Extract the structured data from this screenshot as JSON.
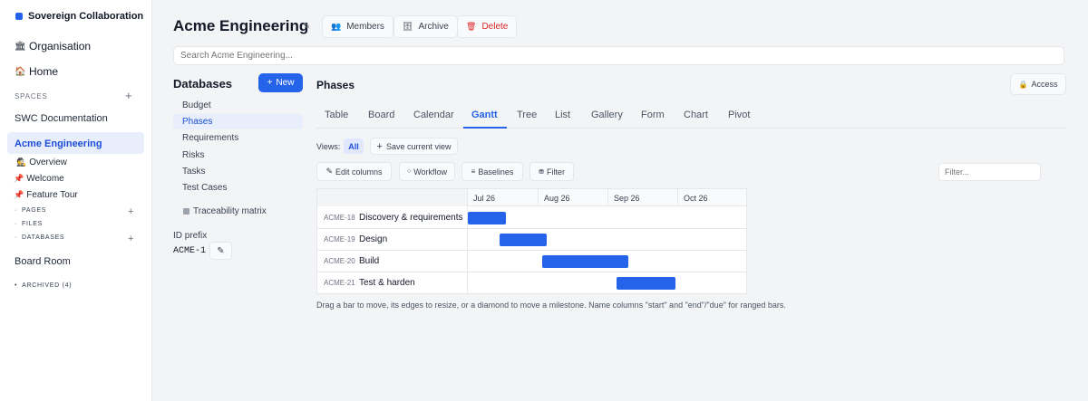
{
  "app": {
    "name": "Sovereign Collaboration"
  },
  "nav": {
    "organisation": "Organisation",
    "home": "Home"
  },
  "spaces": {
    "heading": "SPACES",
    "plus": "+",
    "items": [
      "SWC Documentation",
      "Acme Engineering",
      "Board Room"
    ],
    "sub": {
      "overview": "Overview",
      "welcome": "Welcome",
      "tour": "Feature Tour",
      "pages": "PAGES",
      "files": "FILES",
      "databases": "DATABASES",
      "bullet": "·"
    },
    "archived": "ARCHIVED (4)",
    "archived_bullet": "•"
  },
  "header": {
    "title": "Acme Engineering",
    "pencil": "✎",
    "members": "Members",
    "archive": "Archive",
    "delete": "Delete"
  },
  "search": {
    "placeholder": "Search Acme Engineering..."
  },
  "databases": {
    "heading": "Databases",
    "new_label": "New",
    "new_plus": "+",
    "items": [
      "Budget",
      "Phases",
      "Requirements",
      "Risks",
      "Tasks",
      "Test Cases"
    ],
    "traceability": "Traceability matrix",
    "id_prefix_label": "ID prefix",
    "id_prefix_value": "ACME-1",
    "edit_glyph": "✎"
  },
  "view": {
    "title": "Phases",
    "access": "Access",
    "tabs": [
      "Table",
      "Board",
      "Calendar",
      "Gantt",
      "Tree",
      "List",
      "Gallery",
      "Form",
      "Chart",
      "Pivot"
    ],
    "active_tab": "Gantt",
    "views_label": "Views:",
    "all": "All",
    "save_view": "Save current view",
    "save_plus": "+",
    "edit_columns": "Edit columns",
    "edit_glyph": "✎",
    "workflow": "Workflow",
    "workflow_glyph": "○",
    "baselines": "Baselines",
    "baselines_glyph": "≡",
    "filter": "Filter",
    "filter_glyph": "⛃",
    "filter_placeholder": "Filter..."
  },
  "gantt": {
    "months": [
      "Jul 26",
      "Aug 26",
      "Sep 26",
      "Oct 26"
    ],
    "rows": [
      {
        "id": "ACME-18",
        "name": "Discovery & requirements"
      },
      {
        "id": "ACME-19",
        "name": "Design"
      },
      {
        "id": "ACME-20",
        "name": "Build"
      },
      {
        "id": "ACME-21",
        "name": "Test & harden"
      }
    ],
    "note": "Drag a bar to move, its edges to resize, or a diamond to move a milestone. Name columns \"start\" and \"end\"/\"due\" for ranged bars."
  },
  "colors": {
    "accent": "#2563eb",
    "danger": "#dc2626",
    "sidebar_active_bg": "#e8eefc"
  }
}
